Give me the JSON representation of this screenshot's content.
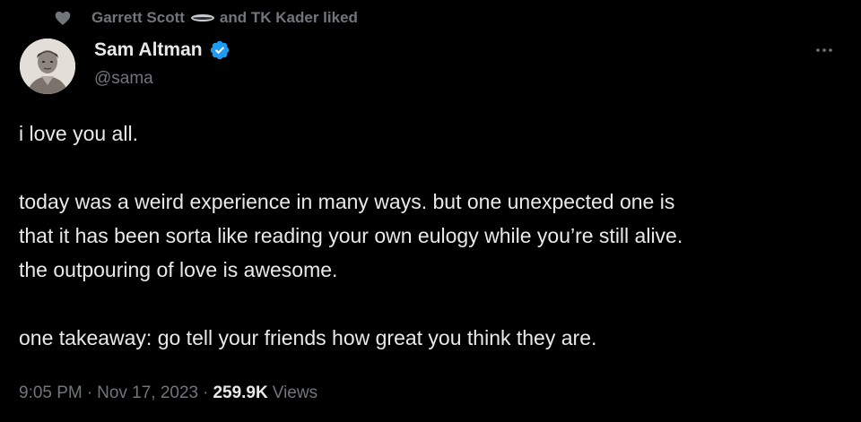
{
  "social_context": {
    "first_user": "Garrett Scott",
    "connector": "and TK Kader liked",
    "icon": "heart-icon",
    "inline_emoji": "oval-emoji"
  },
  "author": {
    "name": "Sam Altman",
    "handle": "@sama",
    "verified": true,
    "verified_color": "#1d9bf0",
    "avatar_icon": "avatar"
  },
  "more_menu": {
    "icon": "more-horizontal-icon"
  },
  "tweet": {
    "paragraphs": [
      [
        "i love you all."
      ],
      [
        "today was a weird experience in many ways. but one unexpected one is",
        "that it has been sorta like reading your own eulogy while you’re still alive.",
        "the outpouring of love is awesome."
      ],
      [
        "one takeaway: go tell your friends how great you think they are."
      ]
    ]
  },
  "meta": {
    "time": "9:05 PM",
    "separator": "·",
    "date": "Nov 17, 2023",
    "views_count": "259.9K",
    "views_label": "Views"
  },
  "colors": {
    "background": "#000000",
    "primary_text": "#e7e9ea",
    "secondary_text": "#71767b",
    "accent": "#1d9bf0"
  }
}
